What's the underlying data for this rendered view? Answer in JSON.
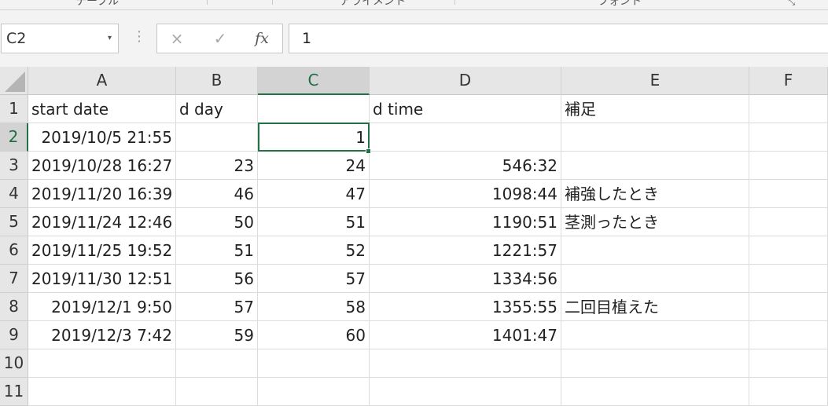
{
  "ribbon": {
    "groups": [
      "テーブル",
      "アライメント",
      "フォント"
    ]
  },
  "formula_bar": {
    "name_box": "C2",
    "cancel_icon": "×",
    "enter_icon": "✓",
    "fx_label": "fx",
    "value": "1"
  },
  "columns": [
    "A",
    "B",
    "C",
    "D",
    "E",
    "F"
  ],
  "active_column": "C",
  "active_row": "2",
  "rows": [
    {
      "n": "1",
      "cells": [
        "start date",
        "d day",
        "",
        "d time",
        "補足",
        ""
      ]
    },
    {
      "n": "2",
      "cells": [
        "2019/10/5 21:55",
        "",
        "1",
        "",
        "",
        ""
      ]
    },
    {
      "n": "3",
      "cells": [
        "2019/10/28 16:27",
        "23",
        "24",
        "546:32",
        "",
        ""
      ]
    },
    {
      "n": "4",
      "cells": [
        "2019/11/20 16:39",
        "46",
        "47",
        "1098:44",
        "補強したとき",
        ""
      ]
    },
    {
      "n": "5",
      "cells": [
        "2019/11/24 12:46",
        "50",
        "51",
        "1190:51",
        "茎測ったとき",
        ""
      ]
    },
    {
      "n": "6",
      "cells": [
        "2019/11/25 19:52",
        "51",
        "52",
        "1221:57",
        "",
        ""
      ]
    },
    {
      "n": "7",
      "cells": [
        "2019/11/30 12:51",
        "56",
        "57",
        "1334:56",
        "",
        ""
      ]
    },
    {
      "n": "8",
      "cells": [
        "2019/12/1 9:50",
        "57",
        "58",
        "1355:55",
        "二回目植えた",
        ""
      ]
    },
    {
      "n": "9",
      "cells": [
        "2019/12/3 7:42",
        "59",
        "60",
        "1401:47",
        "",
        ""
      ]
    },
    {
      "n": "10",
      "cells": [
        "",
        "",
        "",
        "",
        "",
        ""
      ]
    },
    {
      "n": "11",
      "cells": [
        "",
        "",
        "",
        "",
        "",
        ""
      ]
    }
  ],
  "colors": {
    "accent": "#217346",
    "header_bg": "#e6e6e6",
    "gridline": "#dcdcdc"
  }
}
